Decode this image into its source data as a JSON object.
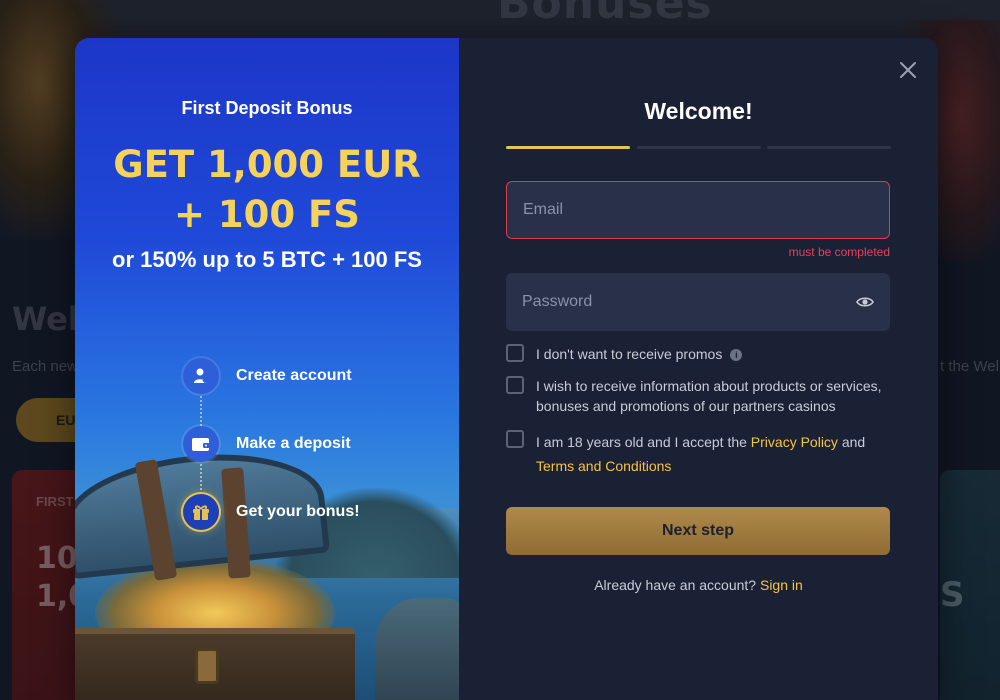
{
  "background": {
    "title": "Bonuses",
    "welcome": "Wel",
    "sub_left": "Each new",
    "sub_right": "t the Wel",
    "pill": "EU",
    "card_left_label": "FIRST",
    "card_left_big_1": "10",
    "card_left_big_2": "1,0",
    "card_right_big": "S"
  },
  "promo": {
    "heading": "First Deposit Bonus",
    "amount_line1": "GET 1,000 EUR",
    "amount_line2": "+ 100 FS",
    "alternative": "or 150% up to 5 BTC + 100 FS",
    "steps": [
      {
        "label": "Create account",
        "icon": "user-check-icon"
      },
      {
        "label": "Make a deposit",
        "icon": "wallet-icon"
      },
      {
        "label": "Get your bonus!",
        "icon": "gift-icon"
      }
    ]
  },
  "form": {
    "title": "Welcome!",
    "steps_total": 3,
    "current_step": 1,
    "email_placeholder": "Email",
    "email_error": "must be completed",
    "password_placeholder": "Password",
    "checkboxes": [
      {
        "text": "I don't want to receive promos"
      },
      {
        "text": "I wish to receive information about products or services, bonuses and promotions of our partners casinos"
      },
      {
        "text_before": "I am 18 years old and I accept the ",
        "link1": "Privacy Policy",
        "text_mid": " and",
        "link2": "Terms and Conditions"
      }
    ],
    "next_label": "Next step",
    "signin_prompt": "Already have an account?",
    "signin_link": "Sign in"
  },
  "colors": {
    "accent": "#e9c24e",
    "error": "#e8405a",
    "link": "#f5c443",
    "panel": "#1b2134",
    "promo_blue": "#1f49d8"
  }
}
